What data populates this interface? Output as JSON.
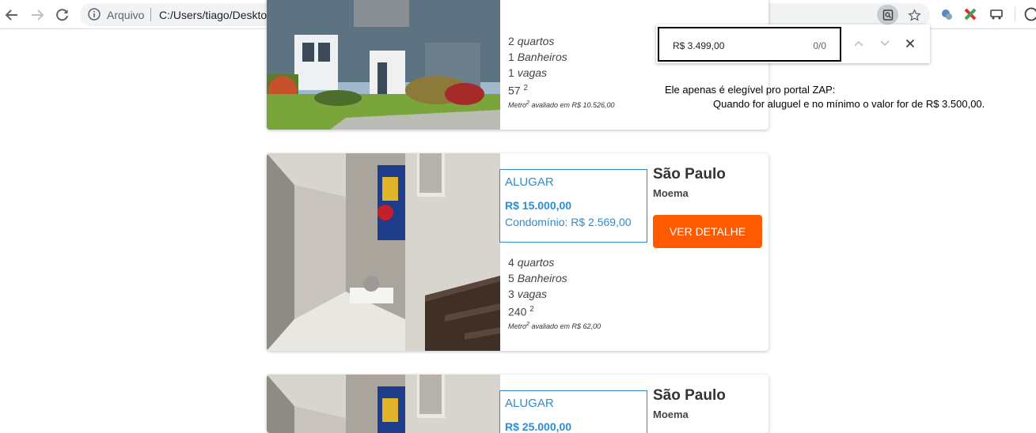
{
  "browser": {
    "scheme_label": "Arquivo",
    "url": "C:/Users/tiago/Desktop/zap/index.html"
  },
  "find_bar": {
    "query": "R$ 3.499,00",
    "count": "0/0"
  },
  "note": {
    "line1": "Ele apenas é elegível pro portal ZAP:",
    "line2": "Quando for aluguel e no mínimo o valor for de R$ 3.500,00."
  },
  "listings": [
    {
      "bedrooms": "2",
      "bedrooms_label": "quartos",
      "bathrooms": "1",
      "bathrooms_label": "Banheiros",
      "parking": "1",
      "parking_label": "vagas",
      "area": "57",
      "area_sup": "2",
      "sqm_label": "Metro",
      "sqm_sup": "2",
      "sqm_text": "avaliado em R$ 10.526,00"
    },
    {
      "business_type": "ALUGAR",
      "price": "R$ 15.000,00",
      "condo": "Condomínio: R$ 2.569,00",
      "city": "São Paulo",
      "neighborhood": "Moema",
      "detail_button": "VER DETALHE",
      "bedrooms": "4",
      "bedrooms_label": "quartos",
      "bathrooms": "5",
      "bathrooms_label": "Banheiros",
      "parking": "3",
      "parking_label": "vagas",
      "area": "240",
      "area_sup": "2",
      "sqm_label": "Metro",
      "sqm_sup": "2",
      "sqm_text": "avaliado em R$ 62,00"
    },
    {
      "business_type": "ALUGAR",
      "price": "R$ 25.000,00",
      "city": "São Paulo",
      "neighborhood": "Moema"
    }
  ],
  "icons": {
    "back": "arrow-left-icon",
    "forward": "arrow-right-icon",
    "reload": "reload-icon",
    "info": "info-icon",
    "lens": "find-in-page-icon",
    "star": "star-icon",
    "find_prev": "chevron-up-icon",
    "find_next": "chevron-down-icon",
    "find_close": "close-icon"
  },
  "colors": {
    "accent_blue": "#2e8ccf",
    "button_orange": "#ff5a00"
  }
}
